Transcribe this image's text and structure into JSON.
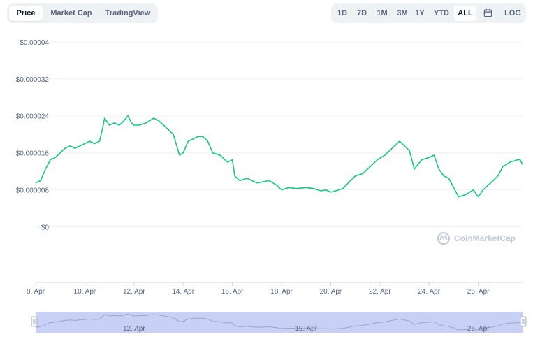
{
  "tabs": [
    {
      "label": "Price",
      "active": true
    },
    {
      "label": "Market Cap",
      "active": false
    },
    {
      "label": "TradingView",
      "active": false
    }
  ],
  "ranges": [
    {
      "label": "1D"
    },
    {
      "label": "7D"
    },
    {
      "label": "1M"
    },
    {
      "label": "3M"
    },
    {
      "label": "1Y"
    },
    {
      "label": "YTD"
    },
    {
      "label": "ALL",
      "active": true
    }
  ],
  "calendar_icon": "calendar-icon",
  "log_label": "LOG",
  "watermark": "CoinMarketCap",
  "colors": {
    "line": "#16c784",
    "navigator": "#c9d0f5",
    "grid": "#eff2f5"
  },
  "navigator_labels": [
    {
      "label": "12. Apr",
      "x": 12
    },
    {
      "label": "19. Apr",
      "x": 19
    },
    {
      "label": "26. Apr",
      "x": 26
    }
  ],
  "chart_data": {
    "type": "line",
    "title": "",
    "xlabel": "",
    "ylabel": "",
    "x_ticks": [
      {
        "label": "8. Apr",
        "x": 8
      },
      {
        "label": "10. Apr",
        "x": 10
      },
      {
        "label": "12. Apr",
        "x": 12
      },
      {
        "label": "14. Apr",
        "x": 14
      },
      {
        "label": "16. Apr",
        "x": 16
      },
      {
        "label": "18. Apr",
        "x": 18
      },
      {
        "label": "20. Apr",
        "x": 20
      },
      {
        "label": "22. Apr",
        "x": 22
      },
      {
        "label": "24. Apr",
        "x": 24
      },
      {
        "label": "26. Apr",
        "x": 26
      }
    ],
    "y_ticks": [
      {
        "label": "$0",
        "value": 0
      },
      {
        "label": "$0.000008",
        "value": 8e-06
      },
      {
        "label": "$0.000016",
        "value": 1.6e-05
      },
      {
        "label": "$0.000024",
        "value": 2.4e-05
      },
      {
        "label": "$0.000032",
        "value": 3.2e-05
      },
      {
        "label": "$0.00004",
        "value": 4e-05
      }
    ],
    "xlim": [
      8,
      27.8
    ],
    "ylim": [
      -1.2e-05,
      4.3e-05
    ],
    "series": [
      {
        "x": [
          8.0,
          8.2,
          8.4,
          8.6,
          8.8,
          9.0,
          9.2,
          9.4,
          9.6,
          9.8,
          10.0,
          10.2,
          10.4,
          10.6,
          10.75,
          10.8,
          11.0,
          11.2,
          11.4,
          11.6,
          11.75,
          11.9,
          12.0,
          12.2,
          12.5,
          12.8,
          13.0,
          13.2,
          13.4,
          13.6,
          13.85,
          14.0,
          14.2,
          14.4,
          14.6,
          14.8,
          15.0,
          15.2,
          15.5,
          15.8,
          16.0,
          16.1,
          16.3,
          16.6,
          17.0,
          17.5,
          17.8,
          18.0,
          18.3,
          18.6,
          19.0,
          19.3,
          19.6,
          19.8,
          20.0,
          20.2,
          20.5,
          20.8,
          21.0,
          21.3,
          21.6,
          21.9,
          22.2,
          22.5,
          22.8,
          23.0,
          23.2,
          23.4,
          23.7,
          24.0,
          24.2,
          24.4,
          24.6,
          24.8,
          25.0,
          25.2,
          25.5,
          25.8,
          26.0,
          26.2,
          26.5,
          26.8,
          27.0,
          27.3,
          27.6,
          27.7,
          27.8
        ],
        "y": [
          9.5e-06,
          1e-05,
          1.25e-05,
          1.45e-05,
          1.5e-05,
          1.6e-05,
          1.7e-05,
          1.75e-05,
          1.7e-05,
          1.75e-05,
          1.8e-05,
          1.85e-05,
          1.8e-05,
          1.85e-05,
          2.2e-05,
          2.35e-05,
          2.2e-05,
          2.25e-05,
          2.2e-05,
          2.3e-05,
          2.4e-05,
          2.25e-05,
          2.2e-05,
          2.2e-05,
          2.25e-05,
          2.35e-05,
          2.3e-05,
          2.2e-05,
          2.1e-05,
          2e-05,
          1.55e-05,
          1.6e-05,
          1.85e-05,
          1.9e-05,
          1.95e-05,
          1.95e-05,
          1.85e-05,
          1.6e-05,
          1.55e-05,
          1.4e-05,
          1.45e-05,
          1.1e-05,
          1e-05,
          1.05e-05,
          9.5e-06,
          1e-05,
          9e-06,
          8e-06,
          8.5e-06,
          8.3e-06,
          8.5e-06,
          8.3e-06,
          7.8e-06,
          8e-06,
          7.5e-06,
          7.8e-06,
          8.3e-06,
          1e-05,
          1.1e-05,
          1.15e-05,
          1.3e-05,
          1.45e-05,
          1.55e-05,
          1.7e-05,
          1.85e-05,
          1.75e-05,
          1.65e-05,
          1.25e-05,
          1.45e-05,
          1.5e-05,
          1.55e-05,
          1.25e-05,
          1.1e-05,
          1.05e-05,
          8.5e-06,
          6.5e-06,
          7e-06,
          8e-06,
          6.5e-06,
          8e-06,
          9.5e-06,
          1.1e-05,
          1.3e-05,
          1.4e-05,
          1.45e-05,
          1.45e-05,
          1.35e-05
        ]
      }
    ],
    "grid": true,
    "legend": "none"
  }
}
